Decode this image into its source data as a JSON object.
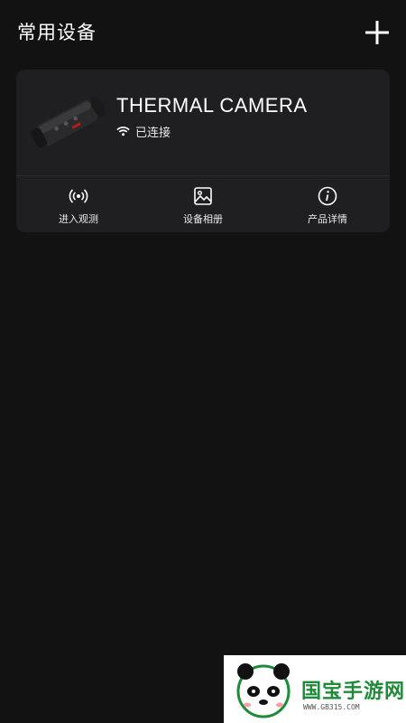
{
  "header": {
    "title": "常用设备",
    "add_icon": "plus-icon"
  },
  "device": {
    "name": "THERMAL CAMERA",
    "status": "已连接",
    "status_icon": "wifi-icon",
    "image": "thermal-camera-image"
  },
  "actions": [
    {
      "label": "进入观测",
      "icon": "live-signal-icon"
    },
    {
      "label": "设备相册",
      "icon": "image-icon"
    },
    {
      "label": "产品详情",
      "icon": "info-icon"
    }
  ],
  "watermark": {
    "text": "国宝手游网",
    "url": "WWW.GB315.COM"
  },
  "colors": {
    "background": "#121212",
    "card": "#1f1f21",
    "text": "#ffffff"
  }
}
